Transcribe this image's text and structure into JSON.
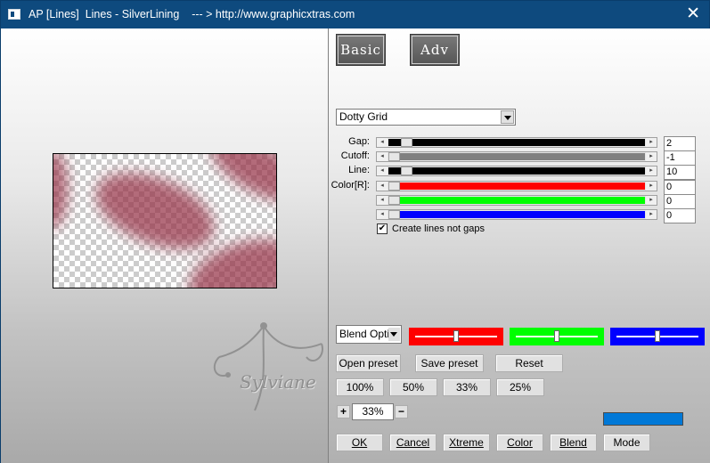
{
  "window": {
    "title": "AP [Lines]  Lines - SilverLining    --- > http://www.graphicxtras.com",
    "close_symbol": "✕"
  },
  "tabs": [
    {
      "label": "Basic"
    },
    {
      "label": "Adv"
    }
  ],
  "preset_select": {
    "value": "Dotty Grid"
  },
  "params": [
    {
      "label": "Gap:",
      "value": "2",
      "fill_color": "#000000",
      "thumb_fraction": 0.05
    },
    {
      "label": "Cutoff:",
      "value": "-1",
      "fill_color": "#808080",
      "thumb_fraction": 0.0
    },
    {
      "label": "Line:",
      "value": "10",
      "fill_color": "#000000",
      "thumb_fraction": 0.05
    },
    {
      "label": "Color[R]:",
      "value": "0",
      "fill_color": "#ff0000",
      "thumb_fraction": 0.0
    },
    {
      "label": "",
      "value": "0",
      "fill_color": "#00ff00",
      "thumb_fraction": 0.0
    },
    {
      "label": "",
      "value": "0",
      "fill_color": "#0000ff",
      "thumb_fraction": 0.0
    }
  ],
  "checkbox": {
    "label": "Create lines not gaps",
    "checked": true,
    "mark": "✔"
  },
  "blend_select": {
    "value": "Blend Optio"
  },
  "color_swatches": [
    {
      "name": "red",
      "color": "#ff0000",
      "level": 0.5
    },
    {
      "name": "green",
      "color": "#00ff00",
      "level": 0.5
    },
    {
      "name": "blue",
      "color": "#0000ff",
      "level": 0.5
    }
  ],
  "preset_buttons": {
    "open": "Open preset",
    "save": "Save preset",
    "reset": "Reset"
  },
  "zoom_buttons": [
    "100%",
    "50%",
    "33%",
    "25%"
  ],
  "zoom_control": {
    "plus": "+",
    "value": "33%",
    "minus": "−"
  },
  "status_color": "#0078d7",
  "action_buttons": {
    "ok": "OK",
    "cancel": "Cancel",
    "xtreme": "Xtreme",
    "color": "Color",
    "blend": "Blend",
    "mode": "Mode"
  },
  "watermark": {
    "text": "Sylviane"
  }
}
